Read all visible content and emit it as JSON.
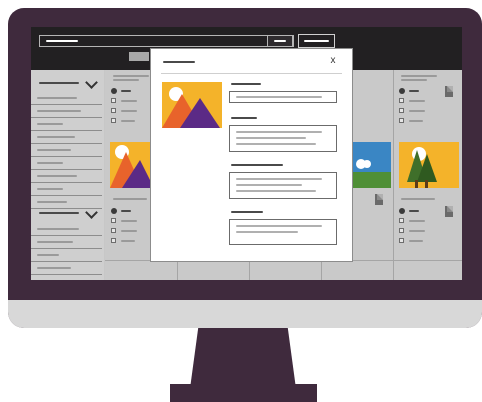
{
  "monitor": {
    "frame_color": "#3f2a3d",
    "screen_bg": "#c7c7c7",
    "chin_color": "#d8d8d8"
  },
  "topbar": {
    "search_icon": "search-icon",
    "button_icon": "button-icon"
  },
  "sidebar": {
    "sections": [
      {
        "expanded": true,
        "icon": "chevron-down-icon"
      },
      {
        "expanded": true,
        "icon": "chevron-down-icon"
      }
    ]
  },
  "grid": {
    "tile_icons": [
      "document-icon",
      "document-icon",
      "document-icon",
      "document-icon"
    ],
    "images": [
      "mountains-image",
      "landscape-image",
      "trees-image"
    ]
  },
  "modal": {
    "close_label": "x",
    "image": "mountains-image",
    "accent_colors": [
      "#f4b32a",
      "#e8632b",
      "#5b2a86"
    ]
  }
}
